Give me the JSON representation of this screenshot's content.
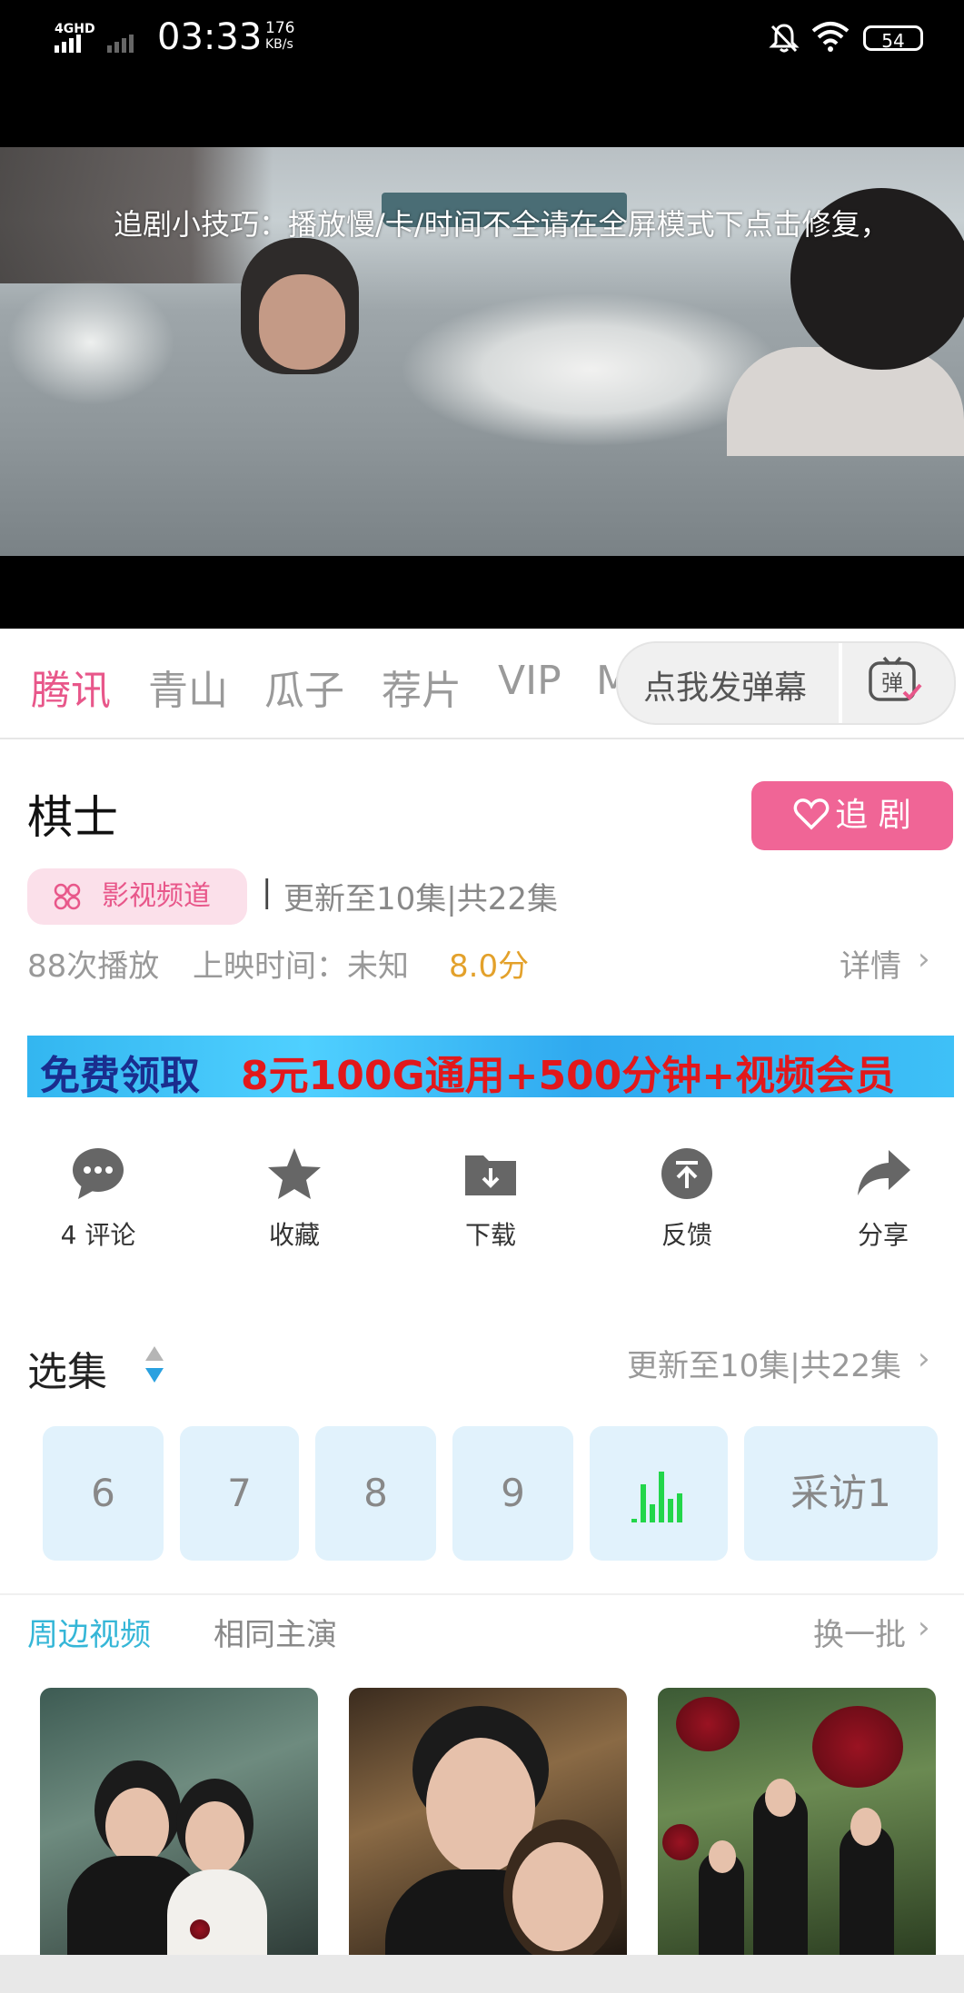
{
  "status_bar": {
    "network": "4GHD",
    "time": "03:33",
    "speed_value": "176",
    "speed_unit": "KB/s",
    "battery": "54"
  },
  "video": {
    "tip": "追剧小技巧：播放慢/卡/时间不全请在全屏模式下点击修复，"
  },
  "source_tabs": [
    "腾讯",
    "青山",
    "瓜子",
    "荐片",
    "VIP",
    "M"
  ],
  "danmu": {
    "placeholder": "点我发弹幕",
    "icon_label": "弹"
  },
  "show": {
    "title": "棋士",
    "follow_label": "追 剧",
    "channel_label": "影视频道",
    "separator": "|",
    "update_text": "更新至10集|共22集",
    "plays": "88次播放",
    "release": "上映时间：未知",
    "score": "8.0分",
    "detail_label": "详情"
  },
  "banner": {
    "left_text": "免费领取",
    "right_text": "8元100G通用+500分钟+视频会员"
  },
  "actions": [
    {
      "label": "4 评论",
      "icon": "comment-icon"
    },
    {
      "label": "收藏",
      "icon": "star-icon"
    },
    {
      "label": "下载",
      "icon": "download-folder-icon"
    },
    {
      "label": "反馈",
      "icon": "feedback-icon"
    },
    {
      "label": "分享",
      "icon": "share-icon"
    }
  ],
  "episodes": {
    "title": "选集",
    "update_text": "更新至10集|共22集",
    "items": [
      "6",
      "7",
      "8",
      "9",
      "",
      "采访1"
    ],
    "playing_index": 4
  },
  "related": {
    "tabs": [
      "周边视频",
      "相同主演"
    ],
    "refresh_label": "换一批"
  },
  "colors": {
    "accent_pink": "#e8578a",
    "follow_button": "#f06596",
    "teal": "#35b6d7",
    "score": "#e3a12b"
  }
}
